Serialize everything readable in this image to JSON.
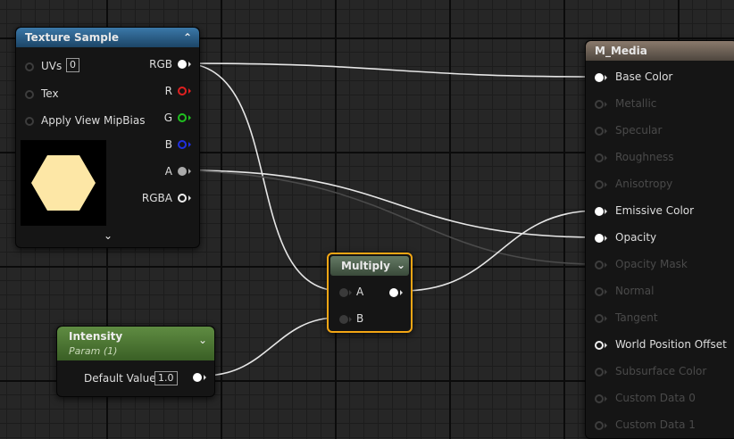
{
  "texture_sample": {
    "title": "Texture Sample",
    "inputs": [
      "UVs",
      "Tex",
      "Apply View MipBias"
    ],
    "uv_value": "0",
    "outputs": [
      "RGB",
      "R",
      "G",
      "B",
      "A",
      "RGBA"
    ]
  },
  "intensity": {
    "title": "Intensity",
    "subtitle": "Param (1)",
    "value_label": "Default Value",
    "value": "1.0"
  },
  "multiply": {
    "title": "Multiply",
    "inputs": [
      "A",
      "B"
    ]
  },
  "material": {
    "title": "M_Media",
    "pins": [
      {
        "label": "Base Color",
        "active": true
      },
      {
        "label": "Metallic",
        "active": false
      },
      {
        "label": "Specular",
        "active": false
      },
      {
        "label": "Roughness",
        "active": false
      },
      {
        "label": "Anisotropy",
        "active": false
      },
      {
        "label": "Emissive Color",
        "active": true
      },
      {
        "label": "Opacity",
        "active": true
      },
      {
        "label": "Opacity Mask",
        "active": false
      },
      {
        "label": "Normal",
        "active": false
      },
      {
        "label": "Tangent",
        "active": false
      },
      {
        "label": "World Position Offset",
        "active": true
      },
      {
        "label": "Subsurface Color",
        "active": false
      },
      {
        "label": "Custom Data 0",
        "active": false
      },
      {
        "label": "Custom Data 1",
        "active": false
      }
    ]
  },
  "colors": {
    "texture_header": "#2b5f86",
    "param_header": "#4f7a34",
    "multiply_header": "#4a5e4a",
    "material_header": "#6e6258",
    "selection": "#f3a614",
    "pin_r": "#e02020",
    "pin_g": "#20c020",
    "pin_b": "#2030e0",
    "texture_preview": "#fde7a6"
  }
}
